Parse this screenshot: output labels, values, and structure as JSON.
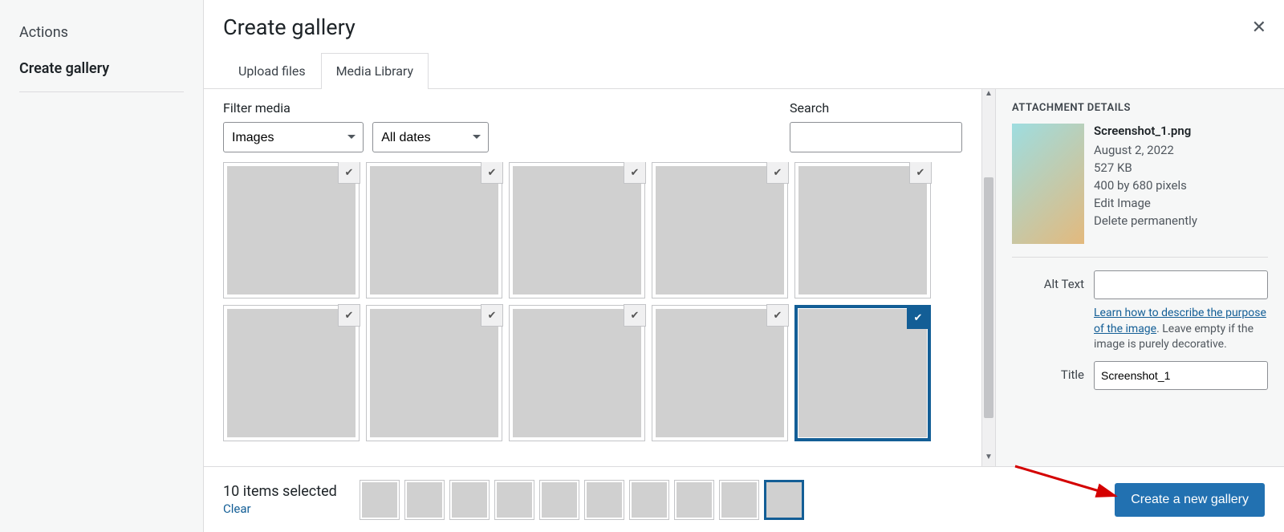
{
  "sidebar": {
    "items": [
      {
        "label": "Actions"
      },
      {
        "label": "Create gallery"
      }
    ]
  },
  "header": {
    "title": "Create gallery"
  },
  "tabs": [
    {
      "label": "Upload files"
    },
    {
      "label": "Media Library"
    }
  ],
  "filters": {
    "filter_label": "Filter media",
    "type_value": "Images",
    "date_value": "All dates",
    "search_label": "Search",
    "search_value": ""
  },
  "grid": {
    "items": [
      {
        "fill": "fill-warm1",
        "selected": true,
        "primary": false
      },
      {
        "fill": "fill-warm2",
        "selected": true,
        "primary": false
      },
      {
        "fill": "fill-warm3",
        "selected": true,
        "primary": false
      },
      {
        "fill": "fill-warm4",
        "selected": true,
        "primary": false
      },
      {
        "fill": "fill-warm5",
        "selected": true,
        "primary": false
      },
      {
        "fill": "fill-warm6",
        "selected": true,
        "primary": false
      },
      {
        "fill": "fill-warm7",
        "selected": true,
        "primary": false
      },
      {
        "fill": "fill-warm8",
        "selected": true,
        "primary": false
      },
      {
        "fill": "fill-warm9",
        "selected": true,
        "primary": false
      },
      {
        "fill": "fill-warm10",
        "selected": true,
        "primary": true
      }
    ]
  },
  "details": {
    "pane_title": "ATTACHMENT DETAILS",
    "filename": "Screenshot_1.png",
    "date": "August 2, 2022",
    "size": "527 KB",
    "dimensions": "400 by 680 pixels",
    "edit_label": "Edit Image",
    "delete_label": "Delete permanently",
    "alt_label": "Alt Text",
    "alt_value": "",
    "alt_help_link": "Learn how to describe the purpose of the image",
    "alt_help_rest": ". Leave empty if the image is purely decorative.",
    "title_label": "Title",
    "title_value": "Screenshot_1"
  },
  "footer": {
    "selection_text": "10 items selected",
    "clear_label": "Clear",
    "cta_label": "Create a new gallery"
  }
}
